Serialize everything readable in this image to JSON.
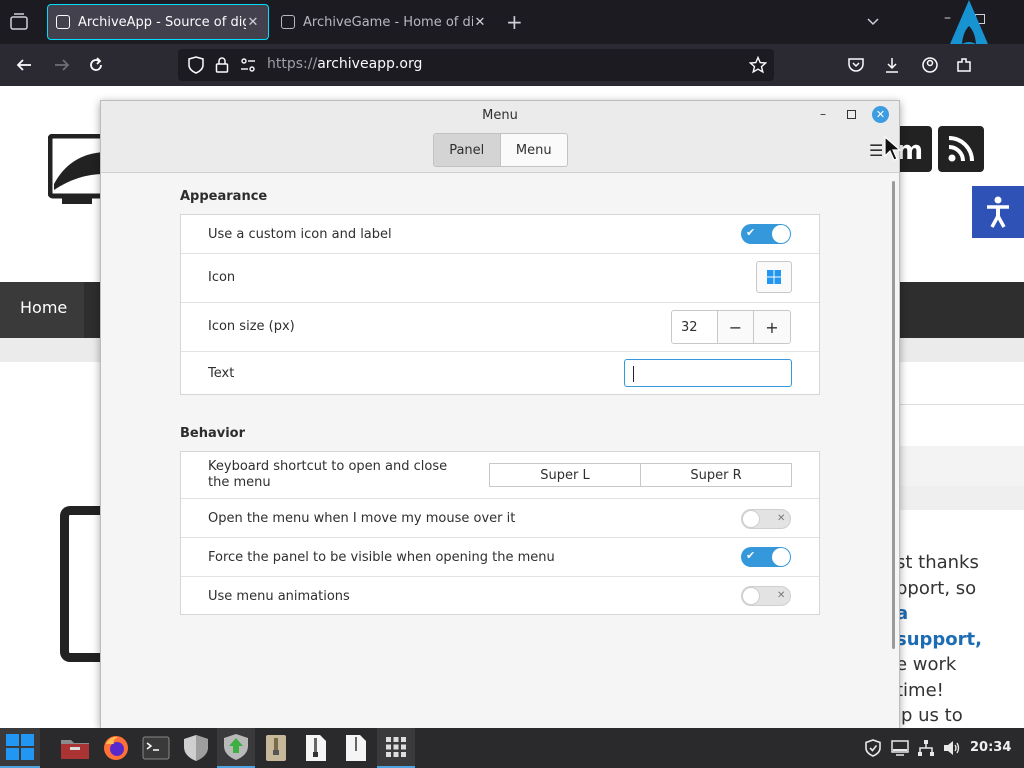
{
  "browser": {
    "tabs": [
      {
        "title": "ArchiveApp - Source of digit",
        "active": true
      },
      {
        "title": "ArchiveGame - Home of digi",
        "active": false
      }
    ],
    "url_scheme": "https://",
    "url_host": "archiveapp.org"
  },
  "site": {
    "nav_home": "Home",
    "text_line1": "st thanks",
    "text_line2": "pport, so",
    "text_line3": "a",
    "text_line4": "support,",
    "text_line5": "e work",
    "text_line6": "time!",
    "text_line7": "lp us to"
  },
  "dialog": {
    "title": "Menu",
    "tabs": {
      "panel": "Panel",
      "menu": "Menu"
    },
    "appearance": {
      "title": "Appearance",
      "custom_icon_label": "Use a custom icon and label",
      "custom_icon_on": true,
      "icon_label": "Icon",
      "icon_size_label": "Icon size (px)",
      "icon_size_value": "32",
      "minus": "−",
      "plus": "+",
      "text_label": "Text",
      "text_value": ""
    },
    "behavior": {
      "title": "Behavior",
      "shortcut_label": "Keyboard shortcut to open and close the menu",
      "shortcut_key1": "Super L",
      "shortcut_key2": "Super R",
      "hover_label": "Open the menu when I move my mouse over it",
      "hover_on": false,
      "force_panel_label": "Force the panel to be visible when opening the menu",
      "force_panel_on": true,
      "animations_label": "Use menu animations",
      "animations_on": false
    }
  },
  "taskbar": {
    "clock": "20:34",
    "apps": [
      "file-manager",
      "firefox",
      "terminal",
      "shield",
      "software-updater",
      "archive-manager",
      "zip-file",
      "text-file",
      "app-grid"
    ]
  },
  "colors": {
    "accent": "#3498db",
    "browser_dark": "#1c1b22",
    "site_link": "#1c6cb4"
  }
}
